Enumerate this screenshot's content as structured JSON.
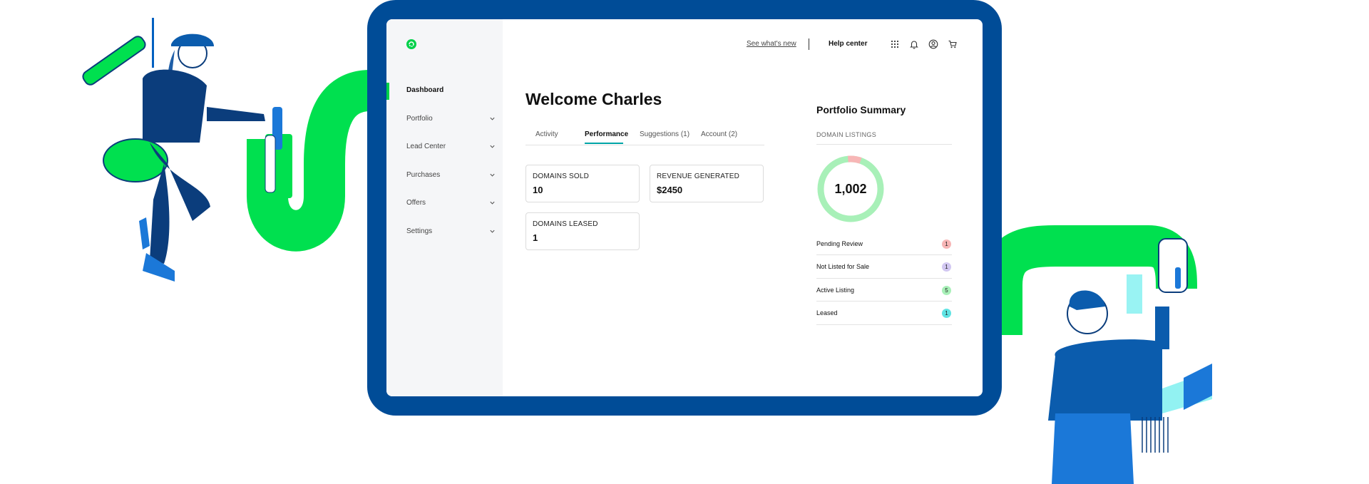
{
  "sidebar": {
    "items": [
      {
        "label": "Dashboard"
      },
      {
        "label": "Portfolio"
      },
      {
        "label": "Lead Center"
      },
      {
        "label": "Purchases"
      },
      {
        "label": "Offers"
      },
      {
        "label": "Settings"
      }
    ]
  },
  "header": {
    "whats_new": "See what's new",
    "help_center": "Help center"
  },
  "main": {
    "welcome": "Welcome Charles",
    "tabs": [
      {
        "label": "Activity"
      },
      {
        "label": "Performance"
      },
      {
        "label": "Suggestions (1)"
      },
      {
        "label": "Account (2)"
      }
    ],
    "cards": [
      {
        "title": "DOMAINS SOLD",
        "value": "10"
      },
      {
        "title": "REVENUE GENERATED",
        "value": "$2450"
      },
      {
        "title": "DOMAINS LEASED",
        "value": "1"
      }
    ]
  },
  "portfolio_summary": {
    "title": "Portfolio Summary",
    "subtitle": "DOMAIN LISTINGS",
    "total": "1,002",
    "rows": [
      {
        "label": "Pending Review",
        "count": "1",
        "color": "#f7b6b6"
      },
      {
        "label": "Not Listed for Sale",
        "count": "1",
        "color": "#d2c8f2"
      },
      {
        "label": "Active Listing",
        "count": "5",
        "color": "#a8f0b8"
      },
      {
        "label": "Leased",
        "count": "1",
        "color": "#5fe3e3"
      }
    ]
  },
  "colors": {
    "frame": "#004c97",
    "accent_green": "#00d14a",
    "tab_underline": "#00a4a6"
  }
}
